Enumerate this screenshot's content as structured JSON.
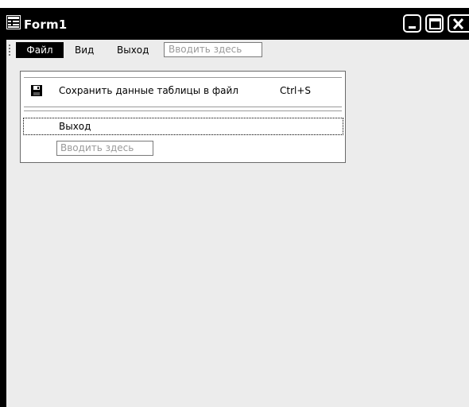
{
  "window": {
    "title": "Form1"
  },
  "menubar": {
    "items": [
      {
        "label": "Файл"
      },
      {
        "label": "Вид"
      },
      {
        "label": "Выход"
      }
    ],
    "type_here_placeholder": "Вводить здесь"
  },
  "file_menu": {
    "save_item": {
      "label": "Сохранить данные таблицы в файл",
      "shortcut": "Ctrl+S",
      "icon": "floppy-disk-icon"
    },
    "exit_item": {
      "label": "Выход"
    },
    "type_here_placeholder": "Вводить здесь"
  },
  "colors": {
    "titlebar": "#000000",
    "client": "#ececec",
    "menu_highlight": "#000000",
    "dropdown_bg": "#ffffff",
    "placeholder_text": "#9a9a9a"
  }
}
